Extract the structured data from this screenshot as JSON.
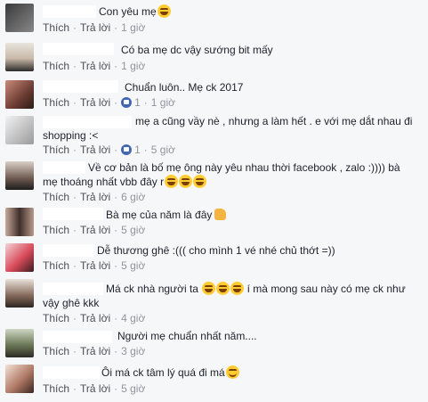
{
  "labels": {
    "like": "Thích",
    "reply": "Trả lời"
  },
  "colors": {
    "link": "#4b4f56",
    "meta": "#90949c",
    "like_badge": "#4267b2",
    "emoji": "#ffcc33"
  },
  "comments": [
    {
      "lines": [
        "Con yêu mẹ"
      ],
      "emoji_after": [
        "laugh-emoji"
      ],
      "likes": "",
      "time": "1 giờ"
    },
    {
      "lines": [
        "Có ba mẹ dc vậy sướng bit mấy"
      ],
      "emoji_after": [],
      "likes": "",
      "time": "1 giờ"
    },
    {
      "lines": [
        "Chuẩn luôn.. Mẹ ck 2017"
      ],
      "emoji_after": [],
      "likes": "1",
      "time": "1 giờ"
    },
    {
      "lines": [
        "mẹ a cũng vầy nè , nhưng a làm hết . e với mẹ dắt nhau đi",
        "shopping :<"
      ],
      "emoji_after": [],
      "likes": "1",
      "time": "5 giờ"
    },
    {
      "lines": [
        "Về cơ bản là bố mẹ ông này yêu nhau thời facebook , zalo :)))) bà",
        "mẹ thoáng nhất vbb đây r"
      ],
      "emoji_after": [
        "laugh-emoji",
        "laugh-emoji",
        "laugh-emoji"
      ],
      "likes": "",
      "time": "6 giờ"
    },
    {
      "lines": [
        "Bà mẹ của năm là đây"
      ],
      "emoji_after": [
        "thumbs-up-icon"
      ],
      "likes": "",
      "time": "5 giờ"
    },
    {
      "lines": [
        "Dễ thương ghê :((( cho mình 1 vé nhé chủ thớt =))"
      ],
      "emoji_after": [],
      "likes": "",
      "time": "5 giờ"
    },
    {
      "lines": [
        "Má ck nhà người ta",
        "vậy ghê kkk"
      ],
      "line1_after": "í mà mong sau này có mẹ ck như",
      "emoji_after": [
        "laugh-emoji",
        "laugh-emoji",
        "laugh-emoji"
      ],
      "likes": "",
      "time": "4 giờ"
    },
    {
      "lines": [
        "Người mẹ chuẩn nhất năm...."
      ],
      "emoji_after": [],
      "likes": "",
      "time": "3 giờ"
    },
    {
      "lines": [
        "Ôi má ck tâm lý quá đi má"
      ],
      "emoji_after": [
        "smile-emoji"
      ],
      "likes": "",
      "time": "5 giờ"
    }
  ]
}
